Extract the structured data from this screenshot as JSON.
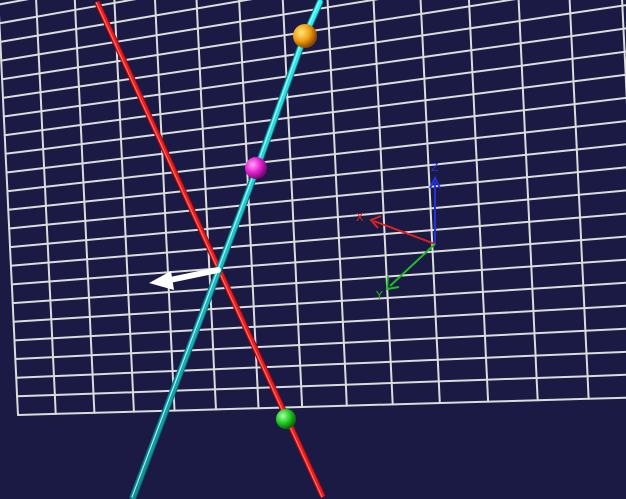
{
  "scene": {
    "background_color": "#1a1a45",
    "grid_color": "#dcdcdc",
    "lines": [
      {
        "id": "red-line",
        "color": "#ee1c1c"
      },
      {
        "id": "cyan-line",
        "color": "#1ee6ee"
      }
    ],
    "points": [
      {
        "id": "orange",
        "color": "#f0a010"
      },
      {
        "id": "magenta",
        "color": "#e620d4"
      },
      {
        "id": "green",
        "color": "#22cc22"
      }
    ],
    "normal_vector_color": "#ffffff"
  },
  "axes_gizmo": {
    "x": {
      "label": "X",
      "color": "#dd2222"
    },
    "y": {
      "label": "Y",
      "color": "#22bb22"
    },
    "z": {
      "label": "Z",
      "color": "#2233dd"
    }
  }
}
